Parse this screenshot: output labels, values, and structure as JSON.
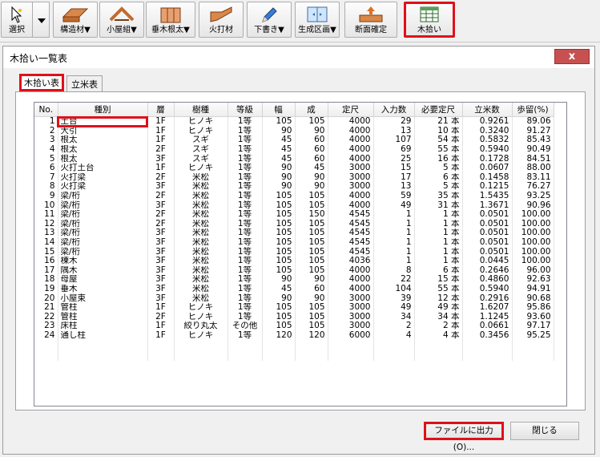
{
  "toolbar": {
    "buttons": [
      {
        "label": "選択",
        "icon": "pointer-icon"
      },
      {
        "label": "構造材▼",
        "icon": "structural-member-icon"
      },
      {
        "label": "小屋組▼",
        "icon": "roof-frame-icon"
      },
      {
        "label": "垂木根太▼",
        "icon": "rafter-joist-icon"
      },
      {
        "label": "火打材",
        "icon": "brace-icon"
      },
      {
        "label": "下書き▼",
        "icon": "pencil-icon"
      },
      {
        "label": "生成区画▼",
        "icon": "generate-area-icon"
      },
      {
        "label": "断面確定",
        "icon": "section-confirm-icon"
      },
      {
        "label": "木拾い",
        "icon": "lumber-takeoff-icon"
      }
    ]
  },
  "dialog": {
    "title": "木拾い一覧表",
    "close_symbol": "x",
    "tabs": [
      "木拾い表",
      "立米表"
    ],
    "export_button": "ファイルに出力(O)...",
    "close_button": "閉じる"
  },
  "table": {
    "headers": [
      "No.",
      "種別",
      "層",
      "樹種",
      "等級",
      "幅",
      "成",
      "定尺",
      "入力数",
      "必要定尺",
      "立米数",
      "歩留(%)"
    ],
    "rows": [
      [
        "1",
        "土台",
        "1F",
        "ヒノキ",
        "1等",
        "105",
        "105",
        "4000",
        "29",
        "21 本",
        "0.9261",
        "89.06"
      ],
      [
        "2",
        "大引",
        "1F",
        "ヒノキ",
        "1等",
        "90",
        "90",
        "4000",
        "13",
        "10 本",
        "0.3240",
        "91.27"
      ],
      [
        "3",
        "根太",
        "1F",
        "スギ",
        "1等",
        "45",
        "60",
        "4000",
        "107",
        "54 本",
        "0.5832",
        "85.43"
      ],
      [
        "4",
        "根太",
        "2F",
        "スギ",
        "1等",
        "45",
        "60",
        "4000",
        "69",
        "55 本",
        "0.5940",
        "90.49"
      ],
      [
        "5",
        "根太",
        "3F",
        "スギ",
        "1等",
        "45",
        "60",
        "4000",
        "25",
        "16 本",
        "0.1728",
        "84.51"
      ],
      [
        "6",
        "火打土台",
        "1F",
        "ヒノキ",
        "1等",
        "90",
        "45",
        "3000",
        "15",
        "5 本",
        "0.0607",
        "88.00"
      ],
      [
        "7",
        "火打梁",
        "2F",
        "米松",
        "1等",
        "90",
        "90",
        "3000",
        "17",
        "6 本",
        "0.1458",
        "83.11"
      ],
      [
        "8",
        "火打梁",
        "3F",
        "米松",
        "1等",
        "90",
        "90",
        "3000",
        "13",
        "5 本",
        "0.1215",
        "76.27"
      ],
      [
        "9",
        "梁/桁",
        "2F",
        "米松",
        "1等",
        "105",
        "105",
        "4000",
        "59",
        "35 本",
        "1.5435",
        "93.25"
      ],
      [
        "10",
        "梁/桁",
        "3F",
        "米松",
        "1等",
        "105",
        "105",
        "4000",
        "49",
        "31 本",
        "1.3671",
        "90.96"
      ],
      [
        "11",
        "梁/桁",
        "2F",
        "米松",
        "1等",
        "105",
        "150",
        "4545",
        "1",
        "1 本",
        "0.0501",
        "100.00"
      ],
      [
        "12",
        "梁/桁",
        "2F",
        "米松",
        "1等",
        "105",
        "105",
        "4545",
        "1",
        "1 本",
        "0.0501",
        "100.00"
      ],
      [
        "13",
        "梁/桁",
        "3F",
        "米松",
        "1等",
        "105",
        "105",
        "4545",
        "1",
        "1 本",
        "0.0501",
        "100.00"
      ],
      [
        "14",
        "梁/桁",
        "3F",
        "米松",
        "1等",
        "105",
        "105",
        "4545",
        "1",
        "1 本",
        "0.0501",
        "100.00"
      ],
      [
        "15",
        "梁/桁",
        "3F",
        "米松",
        "1等",
        "105",
        "105",
        "4545",
        "1",
        "1 本",
        "0.0501",
        "100.00"
      ],
      [
        "16",
        "棟木",
        "3F",
        "米松",
        "1等",
        "105",
        "105",
        "4036",
        "1",
        "1 本",
        "0.0445",
        "100.00"
      ],
      [
        "17",
        "隅木",
        "3F",
        "米松",
        "1等",
        "105",
        "105",
        "4000",
        "8",
        "6 本",
        "0.2646",
        "96.00"
      ],
      [
        "18",
        "母屋",
        "3F",
        "米松",
        "1等",
        "90",
        "90",
        "4000",
        "22",
        "15 本",
        "0.4860",
        "92.63"
      ],
      [
        "19",
        "垂木",
        "3F",
        "米松",
        "1等",
        "45",
        "60",
        "4000",
        "104",
        "55 本",
        "0.5940",
        "94.91"
      ],
      [
        "20",
        "小屋束",
        "3F",
        "米松",
        "1等",
        "90",
        "90",
        "3000",
        "39",
        "12 本",
        "0.2916",
        "90.68"
      ],
      [
        "21",
        "管柱",
        "1F",
        "ヒノキ",
        "1等",
        "105",
        "105",
        "3000",
        "49",
        "49 本",
        "1.6207",
        "95.86"
      ],
      [
        "22",
        "管柱",
        "2F",
        "ヒノキ",
        "1等",
        "105",
        "105",
        "3000",
        "34",
        "34 本",
        "1.1245",
        "93.60"
      ],
      [
        "23",
        "床柱",
        "1F",
        "絞り丸太",
        "その他",
        "105",
        "105",
        "3000",
        "2",
        "2 本",
        "0.0661",
        "97.17"
      ],
      [
        "24",
        "通し柱",
        "1F",
        "ヒノキ",
        "1等",
        "120",
        "120",
        "6000",
        "4",
        "4 本",
        "0.3456",
        "95.25"
      ]
    ]
  }
}
